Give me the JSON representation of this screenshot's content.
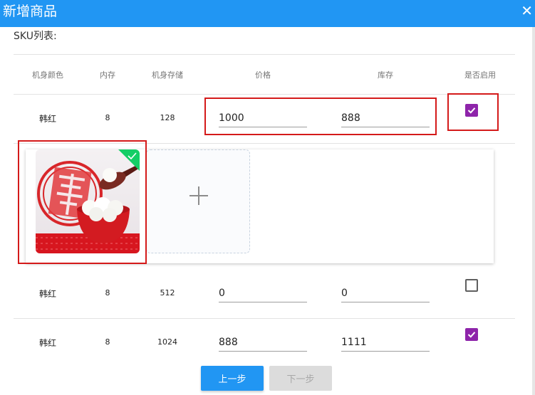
{
  "dialog": {
    "title": "新增商品"
  },
  "sku_list_label": "SKU列表:",
  "columns": [
    "机身颜色",
    "内存",
    "机身存储",
    "价格",
    "库存",
    "是否启用"
  ],
  "rows": [
    {
      "color": "韩红",
      "memory": "8",
      "storage": "128",
      "price": "1000",
      "stock": "888",
      "enabled": true
    },
    {
      "color": "韩红",
      "memory": "8",
      "storage": "512",
      "price": "0",
      "stock": "0",
      "enabled": false
    },
    {
      "color": "韩红",
      "memory": "8",
      "storage": "1024",
      "price": "888",
      "stock": "1111",
      "enabled": true
    }
  ],
  "image_panel": {
    "thumbnail": "fu-character-rice-balls-photo",
    "selected": true,
    "upload_icon": "plus-icon"
  },
  "buttons": {
    "prev": "上一步",
    "next": "下一步"
  },
  "colors": {
    "primary": "#2196f3",
    "checkbox_checked": "#8e24aa",
    "annotation_box": "#d41a1a",
    "selected_badge": "#13ce66"
  }
}
